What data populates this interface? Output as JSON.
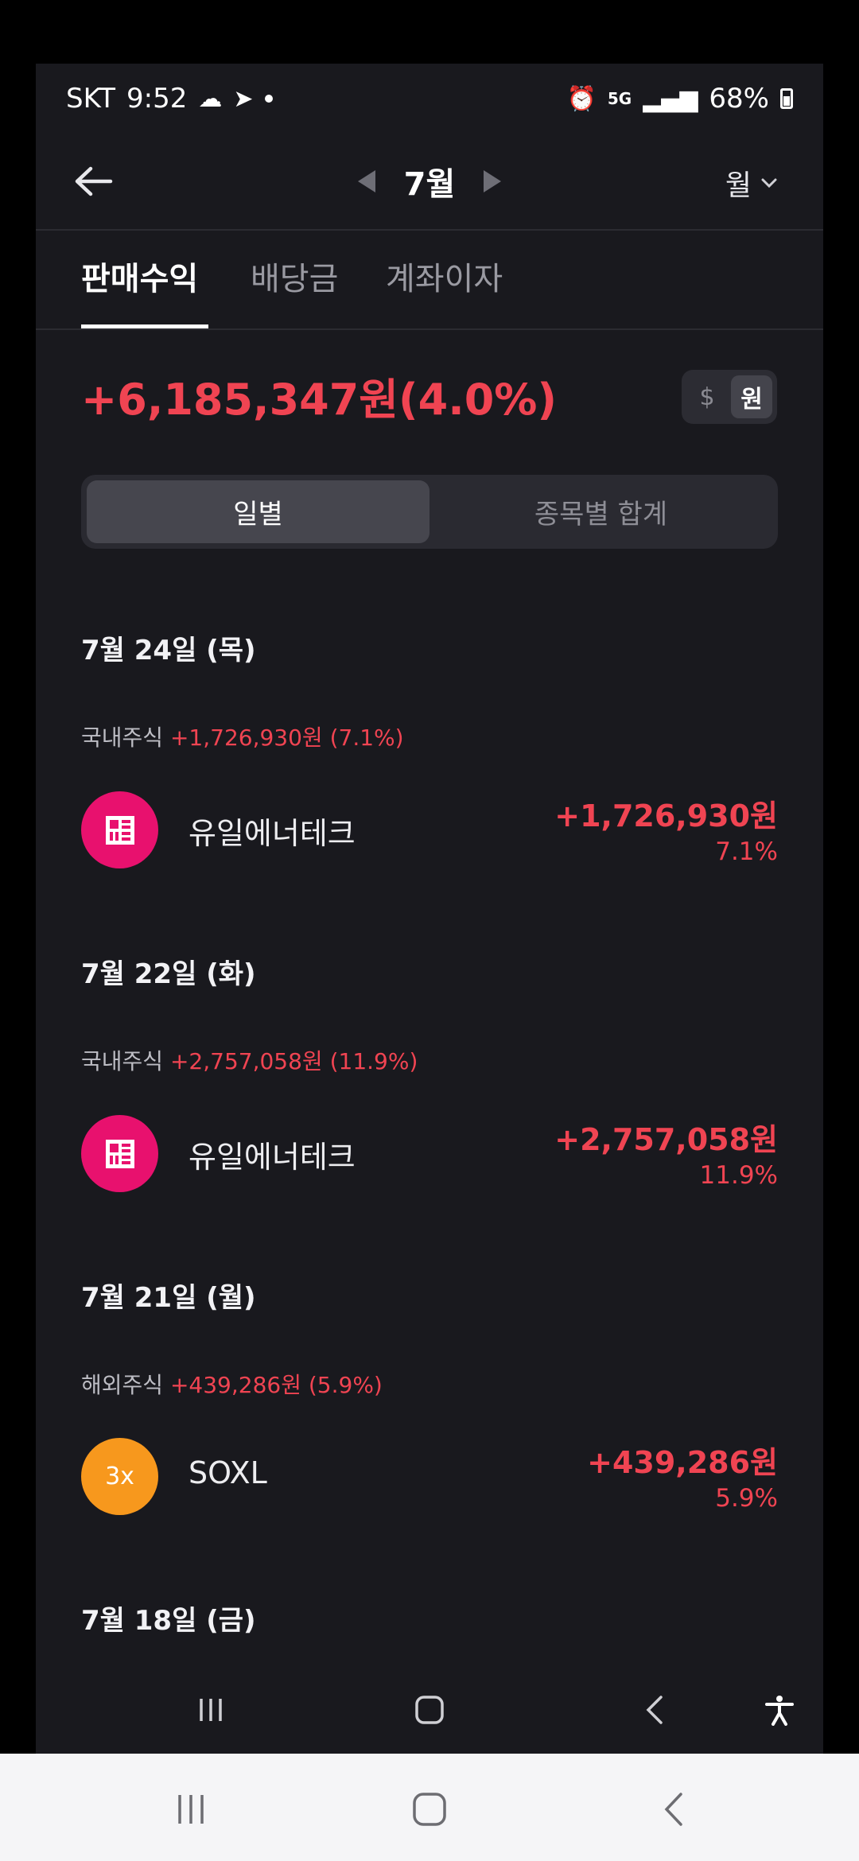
{
  "status_bar": {
    "carrier": "SKT",
    "time": "9:52",
    "battery": "68%",
    "network": "5G"
  },
  "header": {
    "back_icon": "arrow-left-icon",
    "month": "7월",
    "period_select": "월"
  },
  "tabs": [
    {
      "label": "판매수익",
      "active": true
    },
    {
      "label": "배당금",
      "active": false
    },
    {
      "label": "계좌이자",
      "active": false
    }
  ],
  "summary": {
    "total": "+6,185,347원(4.0%)",
    "currency_usd": "$",
    "currency_krw": "원"
  },
  "segment": {
    "daily": "일별",
    "by_stock": "종목별 합계"
  },
  "days": [
    {
      "date": "7월 24일 (목)",
      "category": "국내주식",
      "category_amount": "+1,726,930원 (7.1%)",
      "stock": "유일에너테크",
      "amount": "+1,726,930원",
      "pct": "7.1%"
    },
    {
      "date": "7월 22일 (화)",
      "category": "국내주식",
      "category_amount": "+2,757,058원 (11.9%)",
      "stock": "유일에너테크",
      "amount": "+2,757,058원",
      "pct": "11.9%"
    },
    {
      "date": "7월 21일 (월)",
      "category": "해외주식",
      "category_amount": "+439,286원 (5.9%)",
      "stock": "SOXL",
      "logo_text": "3x",
      "amount": "+439,286원",
      "pct": "5.9%"
    },
    {
      "date": "7월 18일 (금)"
    }
  ],
  "colors": {
    "profit": "#f04452",
    "background": "#19191e",
    "logo_pink": "#e8116e",
    "logo_orange": "#f7981d"
  }
}
